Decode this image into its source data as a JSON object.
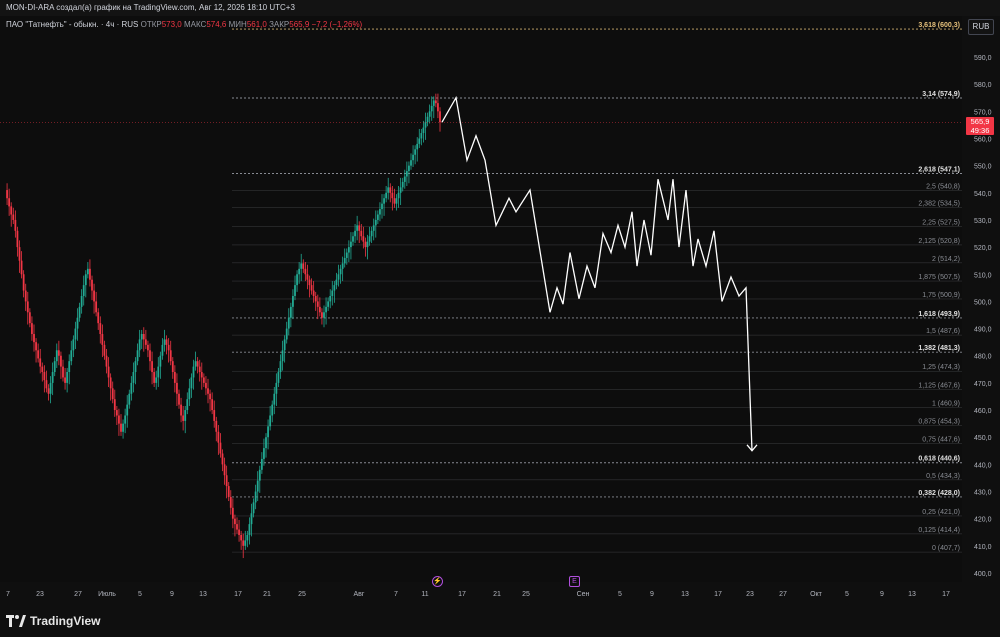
{
  "header": {
    "caption": "MON-DI-ARA создал(а) график на TradingView.com, Авг 12, 2026 18:10 UTC+3"
  },
  "legend": {
    "symbol": "ПАО \"Татнефть\" - обыкн. · 4ч · RUS",
    "open_label": "ОТКР",
    "open_value": "573,0",
    "high_label": "МАКС",
    "high_value": "574,6",
    "low_label": "МИН",
    "low_value": "561,0",
    "close_label": "ЗАКР",
    "close_value": "565,9",
    "change": "−7,2 (−1,26%)"
  },
  "currency": "RUB",
  "price_badge": {
    "price": "565,9",
    "countdown": "49:36",
    "color": "#f23645"
  },
  "colors": {
    "up": "#22ab94",
    "down": "#f23645",
    "fib_line": "#9598a1",
    "fib_top": "#e5c07b",
    "projection": "#ffffff"
  },
  "chart_data": {
    "type": "candlestick",
    "y_axis_ticks": [
      "590,0",
      "580,0",
      "570,0",
      "560,0",
      "550,0",
      "540,0",
      "530,0",
      "520,0",
      "510,0",
      "500,0",
      "490,0",
      "480,0",
      "470,0",
      "460,0",
      "450,0",
      "440,0",
      "430,0",
      "420,0",
      "410,0",
      "400,0"
    ],
    "ylim": [
      400,
      600
    ],
    "x_axis_ticks": [
      "7",
      "23",
      "27",
      "Июль",
      "5",
      "9",
      "13",
      "17",
      "21",
      "25",
      "Авг",
      "7",
      "11",
      "17",
      "21",
      "25",
      "Сен",
      "5",
      "9",
      "13",
      "17",
      "23",
      "27",
      "Окт",
      "5",
      "9",
      "13",
      "17"
    ],
    "fib_levels": [
      {
        "label": "3,618 (600,3)",
        "value": 600.3,
        "bold": true
      },
      {
        "label": "3,14 (574,9)",
        "value": 574.9,
        "bold": true
      },
      {
        "label": "2,618 (547,1)",
        "value": 547.1,
        "bold": true
      },
      {
        "label": "2,5 (540,8)",
        "value": 540.8,
        "bold": false
      },
      {
        "label": "2,382 (534,5)",
        "value": 534.5,
        "bold": false
      },
      {
        "label": "2,25 (527,5)",
        "value": 527.5,
        "bold": false
      },
      {
        "label": "2,125 (520,8)",
        "value": 520.8,
        "bold": false
      },
      {
        "label": "2 (514,2)",
        "value": 514.2,
        "bold": false
      },
      {
        "label": "1,875 (507,5)",
        "value": 507.5,
        "bold": false
      },
      {
        "label": "1,75 (500,9)",
        "value": 500.9,
        "bold": false
      },
      {
        "label": "1,618 (493,9)",
        "value": 493.9,
        "bold": true
      },
      {
        "label": "1,5 (487,6)",
        "value": 487.6,
        "bold": false
      },
      {
        "label": "1,382 (481,3)",
        "value": 481.3,
        "bold": true
      },
      {
        "label": "1,25 (474,3)",
        "value": 474.3,
        "bold": false
      },
      {
        "label": "1,125 (467,6)",
        "value": 467.6,
        "bold": false
      },
      {
        "label": "1 (460,9)",
        "value": 460.9,
        "bold": false
      },
      {
        "label": "0,875 (454,3)",
        "value": 454.3,
        "bold": false
      },
      {
        "label": "0,75 (447,6)",
        "value": 447.6,
        "bold": false
      },
      {
        "label": "0,618 (440,6)",
        "value": 440.6,
        "bold": true
      },
      {
        "label": "0,5 (434,3)",
        "value": 434.3,
        "bold": false
      },
      {
        "label": "0,382 (428,0)",
        "value": 428.0,
        "bold": true
      },
      {
        "label": "0,25 (421,0)",
        "value": 421.0,
        "bold": false
      },
      {
        "label": "0,125 (414,4)",
        "value": 414.4,
        "bold": false
      },
      {
        "label": "0 (407,7)",
        "value": 407.7,
        "bold": false
      }
    ],
    "close_path": [
      541,
      538,
      535,
      532,
      530,
      526,
      520,
      515,
      510,
      504,
      500,
      496,
      492,
      488,
      485,
      482,
      479,
      476,
      474,
      471,
      468,
      466,
      470,
      474,
      478,
      482,
      480,
      476,
      472,
      470,
      474,
      478,
      482,
      486,
      490,
      494,
      498,
      502,
      506,
      510,
      512,
      508,
      504,
      500,
      496,
      492,
      488,
      484,
      480,
      476,
      472,
      468,
      464,
      460,
      458,
      455,
      452,
      455,
      458,
      462,
      466,
      470,
      474,
      478,
      482,
      486,
      488,
      486,
      484,
      482,
      478,
      474,
      470,
      472,
      476,
      480,
      484,
      486,
      484,
      482,
      478,
      474,
      470,
      466,
      462,
      458,
      456,
      460,
      464,
      468,
      472,
      476,
      478,
      476,
      474,
      472,
      470,
      468,
      466,
      464,
      460,
      456,
      452,
      448,
      444,
      440,
      436,
      432,
      428,
      424,
      420,
      418,
      416,
      414,
      412,
      410,
      412,
      414,
      418,
      422,
      426,
      430,
      434,
      438,
      442,
      446,
      450,
      454,
      458,
      462,
      466,
      470,
      474,
      478,
      482,
      486,
      490,
      494,
      498,
      502,
      506,
      510,
      512,
      514,
      512,
      510,
      508,
      506,
      504,
      502,
      500,
      498,
      496,
      494,
      496,
      498,
      500,
      502,
      504,
      506,
      508,
      510,
      512,
      514,
      516,
      518,
      520,
      522,
      524,
      526,
      528,
      526,
      524,
      522,
      520,
      522,
      524,
      526,
      528,
      530,
      532,
      534,
      536,
      538,
      540,
      542,
      540,
      538,
      536,
      538,
      540,
      542,
      544,
      546,
      548,
      550,
      552,
      554,
      556,
      558,
      560,
      562,
      564,
      566,
      568,
      570,
      572,
      574,
      573,
      570,
      566
    ],
    "projection_points": [
      {
        "x": "Авг 12",
        "y": 566
      },
      {
        "x": "Авг 14",
        "y": 575
      },
      {
        "x": "Авг 16",
        "y": 552
      },
      {
        "x": "Авг 18",
        "y": 561
      },
      {
        "x": "Авг 20",
        "y": 552
      },
      {
        "x": "Авг 22",
        "y": 528
      },
      {
        "x": "Авг 24",
        "y": 538
      },
      {
        "x": "Авг 26",
        "y": 533
      },
      {
        "x": "Авг 28",
        "y": 541
      },
      {
        "x": "Сен 1",
        "y": 496
      },
      {
        "x": "Сен 2",
        "y": 505
      },
      {
        "x": "Сен 3",
        "y": 499
      },
      {
        "x": "Сен 4",
        "y": 518
      },
      {
        "x": "Сен 6",
        "y": 501
      },
      {
        "x": "Сен 8",
        "y": 513
      },
      {
        "x": "Сен 9",
        "y": 505
      },
      {
        "x": "Сен 11",
        "y": 525
      },
      {
        "x": "Сен 12",
        "y": 518
      },
      {
        "x": "Сен 13",
        "y": 528
      },
      {
        "x": "Сен 14",
        "y": 520
      },
      {
        "x": "Сен 15",
        "y": 533
      },
      {
        "x": "Сен 16",
        "y": 513
      },
      {
        "x": "Сен 17",
        "y": 530
      },
      {
        "x": "Сен 18",
        "y": 517
      },
      {
        "x": "Сен 19",
        "y": 545
      },
      {
        "x": "Сен 20",
        "y": 530
      },
      {
        "x": "Сен 21",
        "y": 545
      },
      {
        "x": "Сен 22",
        "y": 520
      },
      {
        "x": "Сен 23",
        "y": 541
      },
      {
        "x": "Сен 24",
        "y": 513
      },
      {
        "x": "Сен 25",
        "y": 523
      },
      {
        "x": "Сен 26",
        "y": 513
      },
      {
        "x": "Сен 27",
        "y": 526
      },
      {
        "x": "Сен 28",
        "y": 500
      },
      {
        "x": "Сен 29",
        "y": 509
      },
      {
        "x": "Сен 30",
        "y": 502
      },
      {
        "x": "Окт 1",
        "y": 505
      },
      {
        "x": "Окт 3",
        "y": 445
      }
    ]
  },
  "footer": {
    "logo_text": "TradingView"
  }
}
